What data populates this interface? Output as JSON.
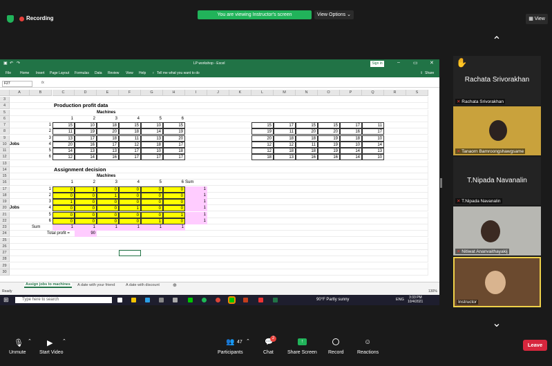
{
  "zoom_top": {
    "recording": "Recording",
    "banner": "You are viewing Instructor's screen",
    "view_options": "View Options",
    "view": "View"
  },
  "excel": {
    "title": "LP workshop - Excel",
    "signin": "Sign in",
    "ribbon_tabs": [
      "File",
      "Home",
      "Insert",
      "Page Layout",
      "Formulas",
      "Data",
      "Review",
      "View",
      "Help"
    ],
    "tell_me": "Tell me what you want to do",
    "share": "Share",
    "name_box": "F27",
    "columns": [
      "A",
      "B",
      "C",
      "D",
      "E",
      "F",
      "G",
      "H",
      "I",
      "J",
      "K",
      "L",
      "M",
      "N",
      "O",
      "P",
      "Q",
      "R",
      "S"
    ],
    "rows": [
      "3",
      "4",
      "5",
      "6",
      "7",
      "8",
      "9",
      "10",
      "11",
      "12",
      "13",
      "14",
      "15",
      "16",
      "17",
      "18",
      "19",
      "20",
      "21",
      "22",
      "23",
      "24",
      "25",
      "26",
      "27",
      "28",
      "29",
      "30"
    ],
    "headings": {
      "profit_title": "Production profit data",
      "machines": "Machines",
      "jobs": "Jobs",
      "assign_title": "Assignment decision",
      "machines2": "Machines",
      "jobs2": "Jobs",
      "sum_col": "Sum",
      "sum_row": "Sum",
      "total_profit_label": "Total profit =",
      "total_profit_value": "90"
    },
    "profit_col_idx": [
      "1",
      "2",
      "3",
      "4",
      "5",
      "6"
    ],
    "profit_rows": [
      {
        "job": "1",
        "vals": [
          "15",
          "10",
          "18",
          "15",
          "10",
          "15"
        ]
      },
      {
        "job": "2",
        "vals": [
          "11",
          "19",
          "20",
          "18",
          "14",
          "19"
        ]
      },
      {
        "job": "3",
        "vals": [
          "13",
          "17",
          "18",
          "11",
          "13",
          "20"
        ]
      },
      {
        "job": "4",
        "vals": [
          "20",
          "16",
          "17",
          "12",
          "18",
          "17"
        ]
      },
      {
        "job": "5",
        "vals": [
          "14",
          "13",
          "13",
          "17",
          "10",
          "18"
        ]
      },
      {
        "job": "6",
        "vals": [
          "12",
          "14",
          "16",
          "17",
          "17",
          "17"
        ]
      }
    ],
    "right_table": [
      [
        "15",
        "17",
        "15",
        "15",
        "17",
        "11"
      ],
      [
        "19",
        "11",
        "20",
        "20",
        "16",
        "17"
      ],
      [
        "20",
        "18",
        "18",
        "19",
        "18",
        "10"
      ],
      [
        "12",
        "12",
        "11",
        "19",
        "10",
        "14"
      ],
      [
        "12",
        "18",
        "18",
        "19",
        "14",
        "13"
      ],
      [
        "18",
        "13",
        "16",
        "16",
        "14",
        "10"
      ]
    ],
    "assign_col_idx": [
      "1",
      "2",
      "3",
      "4",
      "5",
      "6"
    ],
    "assign_rows": [
      {
        "job": "1",
        "vals": [
          "0",
          "1",
          "0",
          "0",
          "0",
          "0"
        ],
        "sum": "1"
      },
      {
        "job": "2",
        "vals": [
          "0",
          "0",
          "1",
          "0",
          "0",
          "0"
        ],
        "sum": "1"
      },
      {
        "job": "3",
        "vals": [
          "1",
          "0",
          "0",
          "0",
          "0",
          "0"
        ],
        "sum": "1"
      },
      {
        "job": "4",
        "vals": [
          "0",
          "0",
          "0",
          "1",
          "0",
          "0"
        ],
        "sum": "1"
      },
      {
        "job": "5",
        "vals": [
          "0",
          "0",
          "0",
          "0",
          "0",
          "1"
        ],
        "sum": "1"
      },
      {
        "job": "6",
        "vals": [
          "0",
          "0",
          "0",
          "0",
          "1",
          "0"
        ],
        "sum": "1"
      }
    ],
    "col_sums": [
      "1",
      "1",
      "1",
      "1",
      "1",
      "1"
    ],
    "sheet_tabs": [
      "Assign jobs to machines",
      "A date with your friend",
      "A date with discount"
    ],
    "status": "Ready",
    "zoom_pct": "130%"
  },
  "taskbar": {
    "search": "Type here to search",
    "weather": "90°F  Partly sunny",
    "lang": "ENG",
    "time": "3:33 PM",
    "date": "10/4/2021"
  },
  "participants": [
    {
      "name": "Rachata Srivorakhan",
      "big": "Rachata Srivorakhan"
    },
    {
      "name": "Tanaorn Bamroongshawgsame"
    },
    {
      "name": "T.Nipada Navanalin",
      "big": "T.Nipada Navanalin"
    },
    {
      "name": "Nitiwat Ananvaithayakij"
    },
    {
      "name": "Instructor"
    }
  ],
  "toolbar": {
    "unmute": "Unmute",
    "start_video": "Start Video",
    "participants": "Participants",
    "participants_count": "47",
    "chat": "Chat",
    "chat_badge": "2",
    "share": "Share Screen",
    "record": "Record",
    "reactions": "Reactions",
    "leave": "Leave"
  },
  "colors": {
    "zoom_green": "#21b35a",
    "excel_green": "#217346",
    "leave_red": "#d7263d",
    "highlight_yellow": "#ffff00",
    "highlight_pink": "#ffccff"
  }
}
